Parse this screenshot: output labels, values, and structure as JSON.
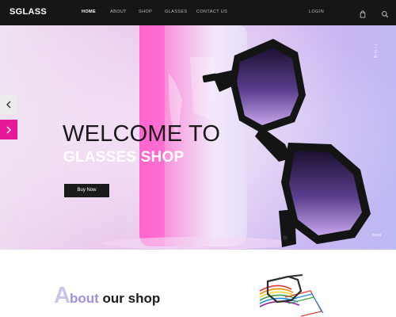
{
  "header": {
    "logo": "SGLASS",
    "nav": [
      "HOME",
      "ABOUT",
      "SHOP",
      "GLASSES",
      "CONTACT US"
    ],
    "login": "LOGIN",
    "icons": [
      "bag-icon",
      "search-icon"
    ]
  },
  "hero": {
    "title_line1": "WELCOME TO",
    "title_line2": "GLASSES SHOP",
    "button": "Buy Now",
    "social": "f   t   in   ig",
    "slide_indicator": "01/03",
    "controls": [
      "chevron-left-icon",
      "chevron-right-icon"
    ]
  },
  "about": {
    "title_initial": "A",
    "title_word1": "bout",
    "title_word2": " our shop"
  },
  "colors": {
    "header_bg": "#161616",
    "accent_pink": "#e7189a",
    "button_bg": "#1b1b1b",
    "about_light": "#c9c7e8",
    "about_mid": "#9f8fe0"
  }
}
